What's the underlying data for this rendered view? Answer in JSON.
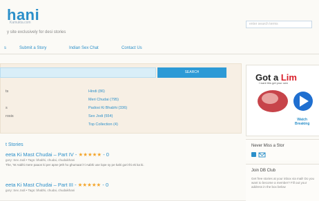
{
  "site": {
    "logo": "hani",
    "logo_sub": "Kamukta.com",
    "tagline": "y site exclusively for desi stories",
    "top_search_placeholder": "enter search terms"
  },
  "nav": {
    "items": [
      "s",
      "Submit a Story",
      "Indian Sex Chat",
      "Contact Us"
    ]
  },
  "search": {
    "button": "SEARCH"
  },
  "stats": [
    {
      "k": "ts",
      "v": "Hindi (86)"
    },
    {
      "k": "",
      "v": "Meri Chudai (795)"
    },
    {
      "k": "s",
      "v": "Padosi Ki Bhabhi (336)"
    },
    {
      "k": "rosis",
      "v": "Sex Jodi (554)"
    },
    {
      "k": "",
      "v": "Top Collection (4)"
    }
  ],
  "section_title": "t Stories",
  "stories": [
    {
      "title": "eeta Ki Mast Chudai – Part IV",
      "stars": "★★★★★",
      "extra": "- 0",
      "meta": "gory: Sex Jodi • Tags: bhabhi, chudai, chudaikhani",
      "excerpt": "The, 'W Aabhi mere paaon ki per apne jeth ho ghumaat i'ri Aabhi use lope sy pe kahi gori thi ek ka ki."
    },
    {
      "title": "eeta Ki Mast Chudai – Part III",
      "stars": "★★★★★",
      "extra": "- 0",
      "meta": "gory: Sex Jodi • Tags: bhabhi, chudai, chudaikhani",
      "excerpt": ""
    }
  ],
  "sidebar": {
    "ad": {
      "head_start": "Got a ",
      "head_hl": "Lim",
      "sub": "I want this get your own",
      "link_1": "Watch",
      "link_2": "Breaking"
    },
    "widget1_title": "Never Miss a Stor",
    "widget2_title": "Join DB Club",
    "widget2_text": "Get free stories at your inbox via mail! Do you want to become a member? Fill out your address in the box below"
  }
}
